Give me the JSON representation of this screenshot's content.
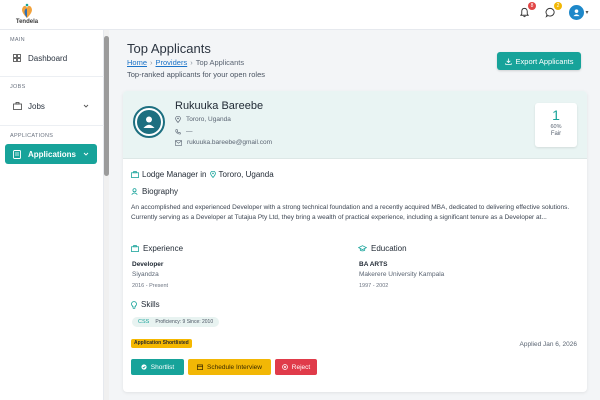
{
  "brand": {
    "name": "Tendela"
  },
  "topbar": {
    "notifications_count": "8",
    "messages_count": "2"
  },
  "sidebar": {
    "sections": [
      {
        "label": "MAIN",
        "items": [
          {
            "label": "Dashboard",
            "icon": "dashboard-icon"
          }
        ]
      },
      {
        "label": "JOBS",
        "items": [
          {
            "label": "Jobs",
            "icon": "briefcase-icon"
          }
        ]
      },
      {
        "label": "APPLICATIONS",
        "items": [
          {
            "label": "Applications",
            "icon": "applications-icon",
            "active": true
          }
        ]
      }
    ]
  },
  "page": {
    "title": "Top Applicants",
    "breadcrumb": [
      "Home",
      "Providers",
      "Top Applicants"
    ],
    "subtitle": "Top-ranked applicants for your open roles",
    "export_label": "Export Applicants"
  },
  "candidate": {
    "name": "Rukuuka Bareebe",
    "location": "Tororo, Uganda",
    "phone": "—",
    "email": "rukuuka.bareebe@gmail.com",
    "rank": "1",
    "match_pct": "60%",
    "match_label": "Fair",
    "job_title": "Lodge Manager in",
    "job_location": "Tororo, Uganda",
    "biography_title": "Biography",
    "biography": "An accomplished and experienced Developer with a strong technical foundation and a recently acquired MBA, dedicated to delivering effective solutions. Currently serving as a Developer at Tutajua Pty Ltd, they bring a wealth of practical experience, including a significant tenure as a Developer at...",
    "experience_title": "Experience",
    "experience": {
      "role": "Developer",
      "company": "Siyandza",
      "period": "2016 - Present"
    },
    "education_title": "Education",
    "education": {
      "degree": "BA ARTS",
      "school": "Makerere University Kampala",
      "period": "1997 - 2002"
    },
    "skills_title": "Skills",
    "skills": [
      {
        "name": "CSS",
        "detail": "Proficiency: 9 Since: 2010"
      }
    ],
    "status": "Application Shortlisted",
    "applied": "Applied Jan 6, 2026",
    "actions": {
      "shortlist": "Shortlist",
      "schedule": "Schedule Interview",
      "reject": "Reject"
    }
  },
  "colors": {
    "accent": "#17a39a",
    "warning": "#f2b705",
    "danger": "#e03b4a",
    "link": "#1a73c8"
  }
}
